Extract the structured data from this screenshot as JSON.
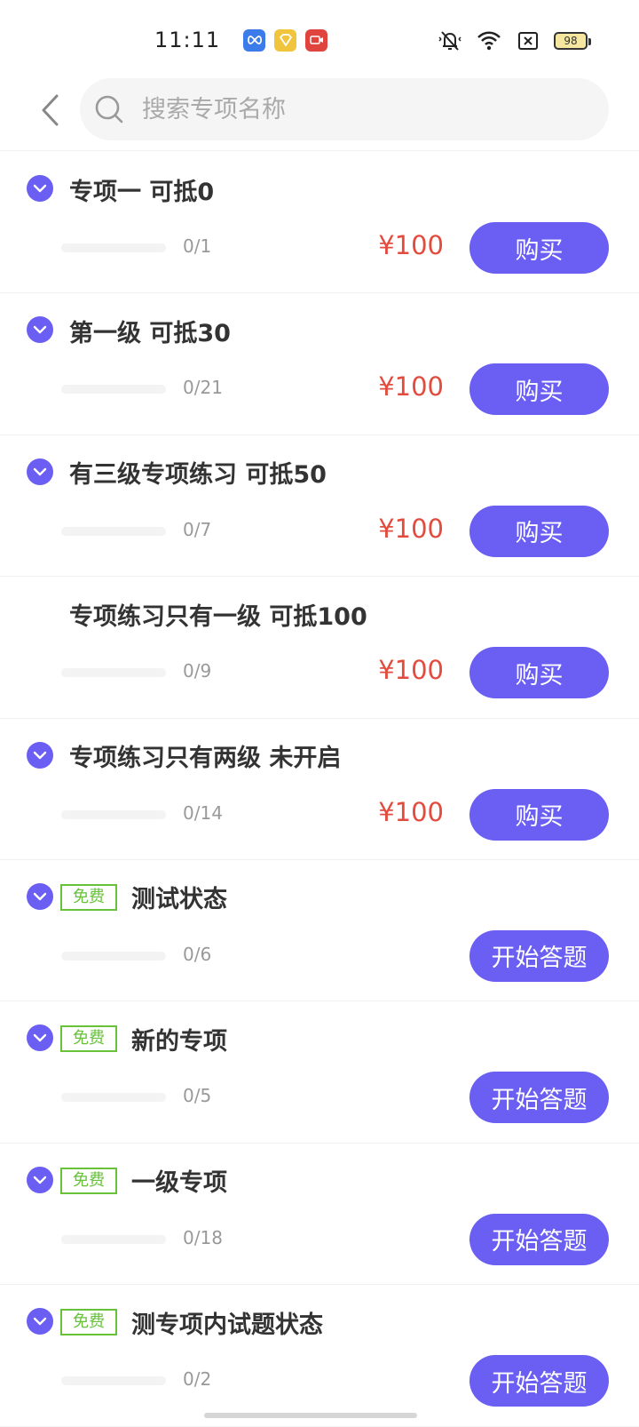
{
  "status_bar": {
    "time": "11:11",
    "battery": "98",
    "apps": [
      {
        "icon": "infinity-app-icon",
        "color": "#3b7bea"
      },
      {
        "icon": "diamond-app-icon",
        "color": "#f0c43d"
      },
      {
        "icon": "video-app-icon",
        "color": "#e0443e"
      }
    ]
  },
  "search": {
    "placeholder": "搜索专项名称",
    "value": ""
  },
  "colors": {
    "accent": "#6a5ef3",
    "price": "#e24c3f",
    "free": "#67c23a"
  },
  "free_label": "免费",
  "items": [
    {
      "title": "专项一 可抵0",
      "progress": "0/1",
      "price": "¥100",
      "button": "购买",
      "chevron": true,
      "free": false
    },
    {
      "title": "第一级 可抵30",
      "progress": "0/21",
      "price": "¥100",
      "button": "购买",
      "chevron": true,
      "free": false
    },
    {
      "title": "有三级专项练习 可抵50",
      "progress": "0/7",
      "price": "¥100",
      "button": "购买",
      "chevron": true,
      "free": false
    },
    {
      "title": "专项练习只有一级 可抵100",
      "progress": "0/9",
      "price": "¥100",
      "button": "购买",
      "chevron": false,
      "free": false
    },
    {
      "title": "专项练习只有两级 未开启",
      "progress": "0/14",
      "price": "¥100",
      "button": "购买",
      "chevron": true,
      "free": false
    },
    {
      "title": "测试状态",
      "progress": "0/6",
      "price": "",
      "button": "开始答题",
      "chevron": true,
      "free": true
    },
    {
      "title": "新的专项",
      "progress": "0/5",
      "price": "",
      "button": "开始答题",
      "chevron": true,
      "free": true
    },
    {
      "title": "一级专项",
      "progress": "0/18",
      "price": "",
      "button": "开始答题",
      "chevron": true,
      "free": true
    },
    {
      "title": "测专项内试题状态",
      "progress": "0/2",
      "price": "",
      "button": "开始答题",
      "chevron": true,
      "free": true
    }
  ]
}
